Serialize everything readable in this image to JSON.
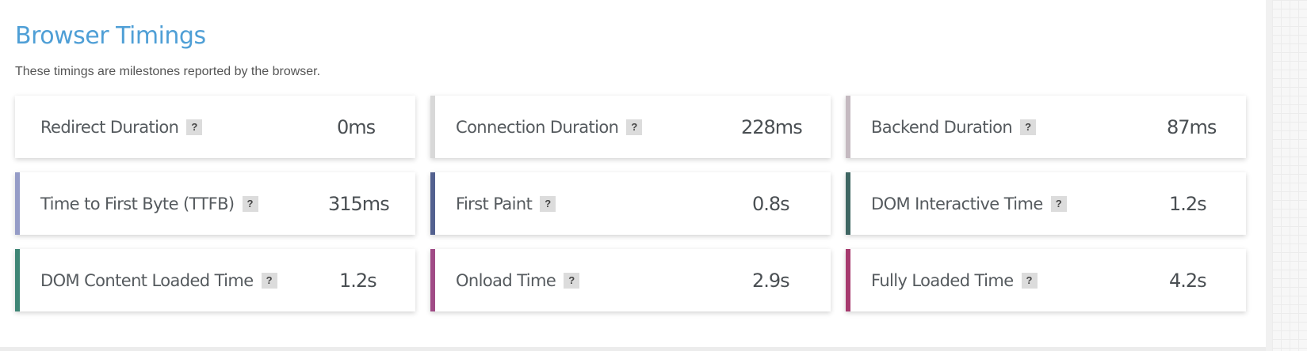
{
  "header": {
    "title": "Browser Timings",
    "subtitle": "These timings are milestones reported by the browser."
  },
  "help_glyph": "?",
  "metrics": [
    {
      "label": "Redirect Duration",
      "value": "0ms",
      "accent": "#ffffff"
    },
    {
      "label": "Connection Duration",
      "value": "228ms",
      "accent": "#d8d8d8"
    },
    {
      "label": "Backend Duration",
      "value": "87ms",
      "accent": "#c4b9c0"
    },
    {
      "label": "Time to First Byte (TTFB)",
      "value": "315ms",
      "accent": "#959cc7"
    },
    {
      "label": "First Paint",
      "value": "0.8s",
      "accent": "#53618f"
    },
    {
      "label": "DOM Interactive Time",
      "value": "1.2s",
      "accent": "#3f6663"
    },
    {
      "label": "DOM Content Loaded Time",
      "value": "1.2s",
      "accent": "#3e8575"
    },
    {
      "label": "Onload Time",
      "value": "2.9s",
      "accent": "#a04b86"
    },
    {
      "label": "Fully Loaded Time",
      "value": "4.2s",
      "accent": "#a63a6e"
    }
  ]
}
